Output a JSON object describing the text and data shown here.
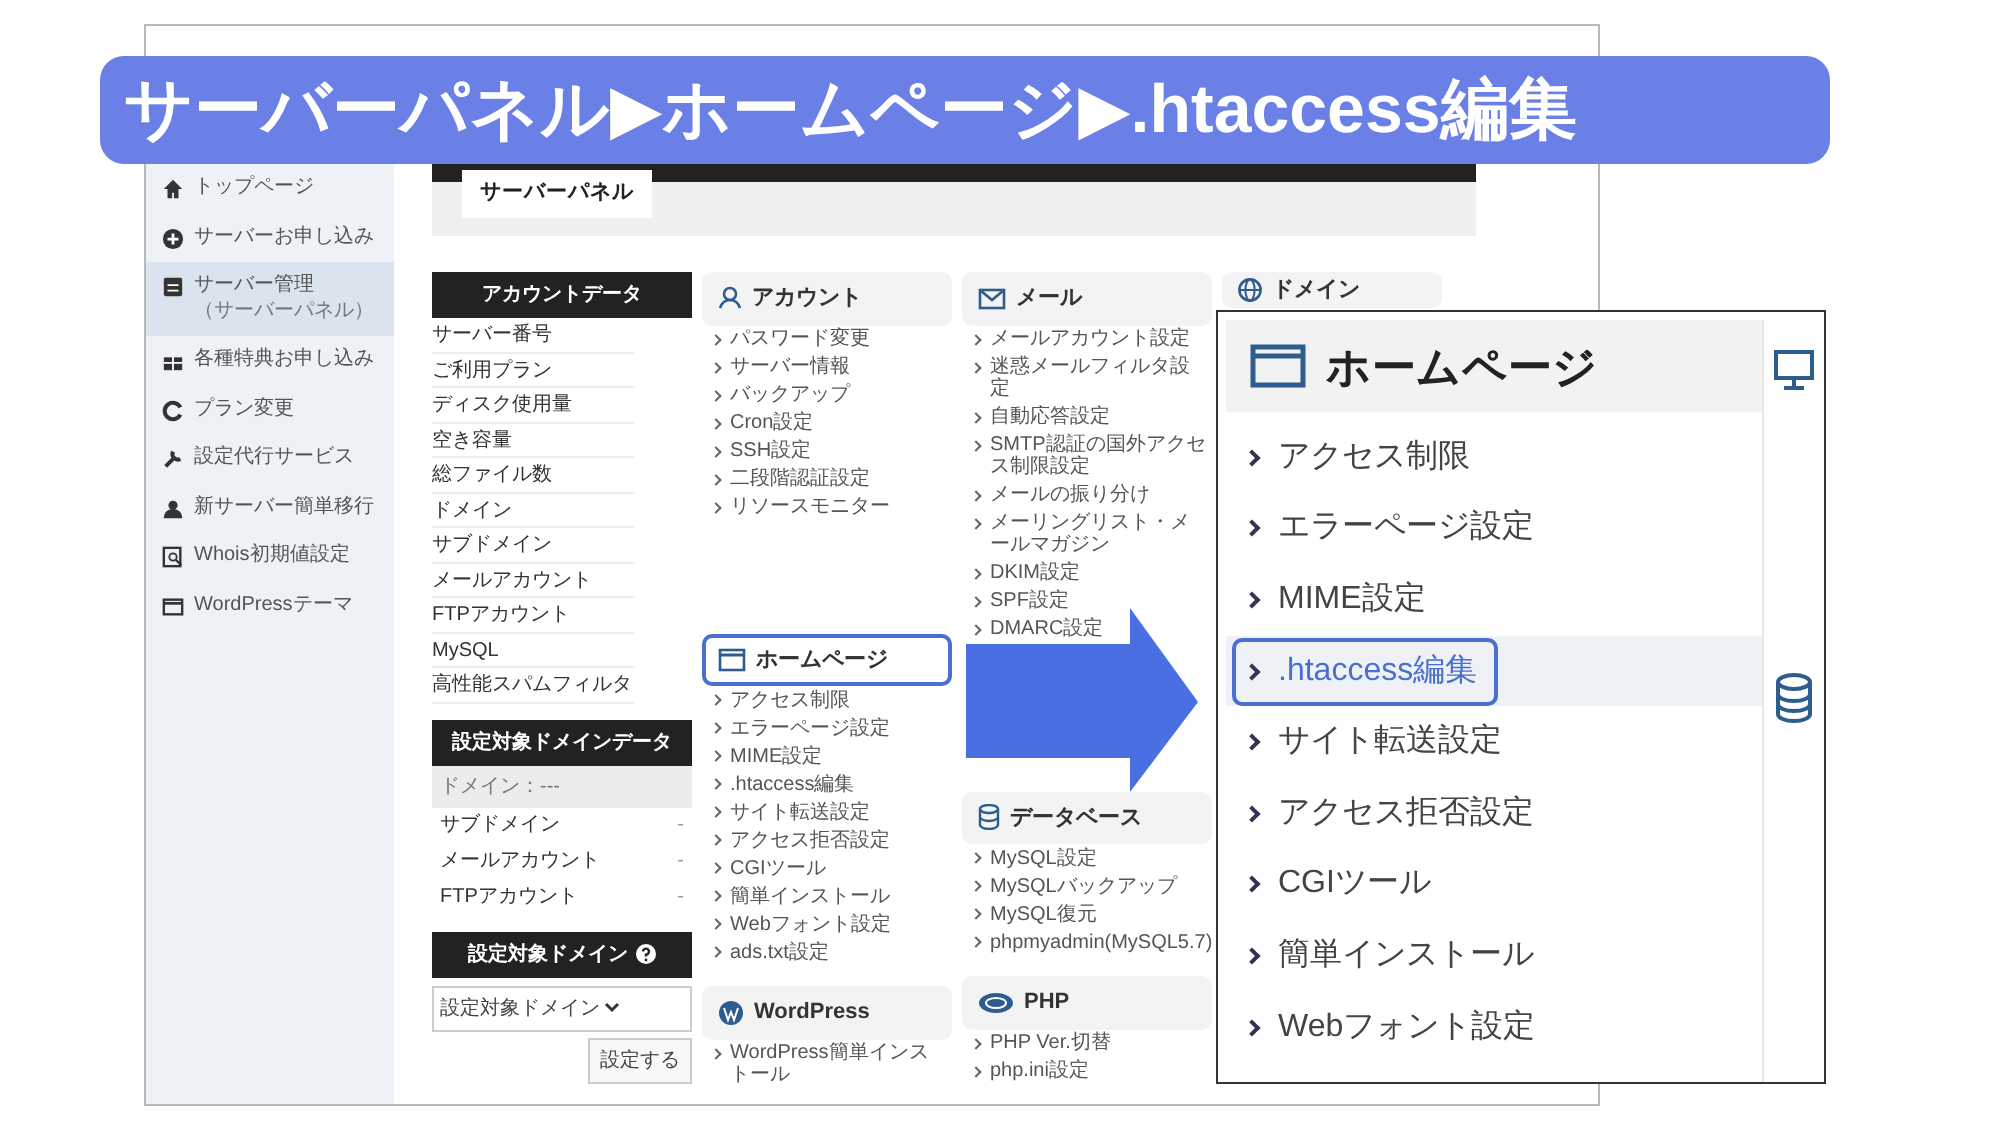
{
  "banner": {
    "title": "サーバーパネル▶ホームページ▶.htaccess編集"
  },
  "sidebar": {
    "items": [
      {
        "label": "トップページ",
        "selected": false
      },
      {
        "label": "サーバーお申し込み",
        "selected": false
      },
      {
        "label": "サーバー管理",
        "sublabel": "（サーバーパネル）",
        "selected": true
      },
      {
        "label": "各種特典お申し込み",
        "selected": false
      },
      {
        "label": "プラン変更",
        "selected": false
      },
      {
        "label": "設定代行サービス",
        "selected": false
      },
      {
        "label": "新サーバー簡単移行",
        "selected": false
      },
      {
        "label": "Whois初期値設定",
        "selected": false
      },
      {
        "label": "WordPressテーマ",
        "selected": false
      }
    ]
  },
  "page_tab": "サーバーパネル",
  "account_data": {
    "title": "アカウントデータ",
    "rows": [
      "サーバー番号",
      "ご利用プラン",
      "ディスク使用量",
      "空き容量",
      "総ファイル数",
      "ドメイン",
      "サブドメイン",
      "メールアカウント",
      "FTPアカウント",
      "MySQL",
      "高性能スパムフィルタ"
    ]
  },
  "domain_data": {
    "title": "設定対象ドメインデータ",
    "domain_row": "ドメイン：---",
    "rows": [
      {
        "label": "サブドメイン",
        "value": "-"
      },
      {
        "label": "メールアカウント",
        "value": "-"
      },
      {
        "label": "FTPアカウント",
        "value": "-"
      }
    ]
  },
  "target_domain": {
    "title": "設定対象ドメイン",
    "select_value": "設定対象ドメイン",
    "button": "設定する"
  },
  "menu_columns": [
    {
      "sections": [
        {
          "title": "アカウント",
          "highlighted": false,
          "items": [
            "パスワード変更",
            "サーバー情報",
            "バックアップ",
            "Cron設定",
            "SSH設定",
            "二段階認証設定",
            "リソースモニター"
          ]
        },
        {
          "title": "ホームページ",
          "highlighted": true,
          "items": [
            "アクセス制限",
            "エラーページ設定",
            "MIME設定",
            ".htaccess編集",
            "サイト転送設定",
            "アクセス拒否設定",
            "CGIツール",
            "簡単インストール",
            "Webフォント設定",
            "ads.txt設定"
          ]
        },
        {
          "title": "WordPress",
          "highlighted": false,
          "items": [
            "WordPress簡単インストール"
          ]
        }
      ]
    },
    {
      "sections": [
        {
          "title": "メール",
          "highlighted": false,
          "items": [
            "メールアカウント設定",
            "迷惑メールフィルタ設定",
            "自動応答設定",
            "SMTP認証の国外アクセス制限設定",
            "メールの振り分け",
            "メーリングリスト・メールマガジン",
            "DKIM設定",
            "SPF設定",
            "DMARC設定"
          ]
        },
        {
          "title": "データベース",
          "highlighted": false,
          "items": [
            "MySQL設定",
            "MySQLバックアップ",
            "MySQL復元",
            "phpmyadmin(MySQL5.7)"
          ]
        },
        {
          "title": "PHP",
          "highlighted": false,
          "items": [
            "PHP Ver.切替",
            "php.ini設定"
          ]
        }
      ]
    },
    {
      "sections": [
        {
          "title": "ドメイン",
          "highlighted": false
        }
      ]
    }
  ],
  "zoom_panel": {
    "title": "ホームページ",
    "items": [
      {
        "label": "アクセス制限",
        "highlighted": false
      },
      {
        "label": "エラーページ設定",
        "highlighted": false
      },
      {
        "label": "MIME設定",
        "highlighted": false
      },
      {
        "label": ".htaccess編集",
        "highlighted": true
      },
      {
        "label": "サイト転送設定",
        "highlighted": false
      },
      {
        "label": "アクセス拒否設定",
        "highlighted": false
      },
      {
        "label": "CGIツール",
        "highlighted": false
      },
      {
        "label": "簡単インストール",
        "highlighted": false
      },
      {
        "label": "Webフォント設定",
        "highlighted": false
      }
    ]
  }
}
